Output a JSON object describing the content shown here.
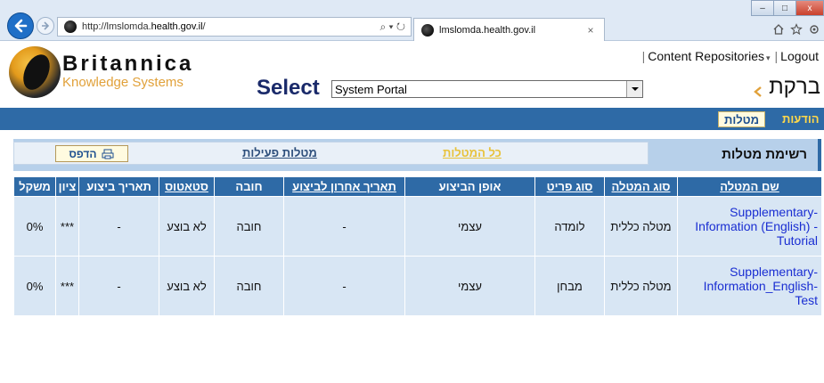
{
  "browser": {
    "url_prefix": "http://lmslomda.",
    "url_domain": "health.gov.il",
    "url_suffix": "/",
    "search_glyph": "⌕ ▾ ↻",
    "tab_title": "lmslomda.health.gov.il",
    "tab_close": "×",
    "win_minimize": "–",
    "win_maximize": "□",
    "win_close": "x"
  },
  "header": {
    "logo_name": "Britannica",
    "logo_sub": "Knowledge Systems",
    "select_label": "Select",
    "portal_value": "System Portal",
    "content_repositories": "Content Repositories",
    "logout": "Logout",
    "brand_hebrew": "ברקת"
  },
  "nav": {
    "tasks": "מטלות",
    "messages": "הודעות"
  },
  "section": {
    "title": "רשימת מטלות",
    "all_tasks": "כל המטלות",
    "active_tasks": "מטלות פעילות",
    "print": "הדפס"
  },
  "table": {
    "headers": [
      "שם המטלה",
      "סוג המטלה",
      "סוג פריט",
      "אופן הביצוע",
      "תאריך אחרון לביצוע",
      "חובה",
      "סטאטוס",
      "תאריך ביצוע",
      "ציון",
      "משקל"
    ],
    "rows": [
      {
        "name": "Supplementary-Information (English) - Tutorial",
        "task_type": "מטלה כללית",
        "item_type": "לומדה",
        "execution": "עצמי",
        "deadline": "-",
        "mandatory": "חובה",
        "status": "לא בוצע",
        "exec_date": "-",
        "grade": "***",
        "weight": "0%"
      },
      {
        "name": "Supplementary-Information_English-Test",
        "task_type": "מטלה כללית",
        "item_type": "מבחן",
        "execution": "עצמי",
        "deadline": "-",
        "mandatory": "חובה",
        "status": "לא בוצע",
        "exec_date": "-",
        "grade": "***",
        "weight": "0%"
      }
    ]
  },
  "colors": {
    "nav_blue": "#2e6aa6",
    "section_bg": "#b7d0ea",
    "row_bg": "#d8e6f4",
    "link_blue": "#1a2ed2",
    "logo_orange": "#e1a13a"
  }
}
